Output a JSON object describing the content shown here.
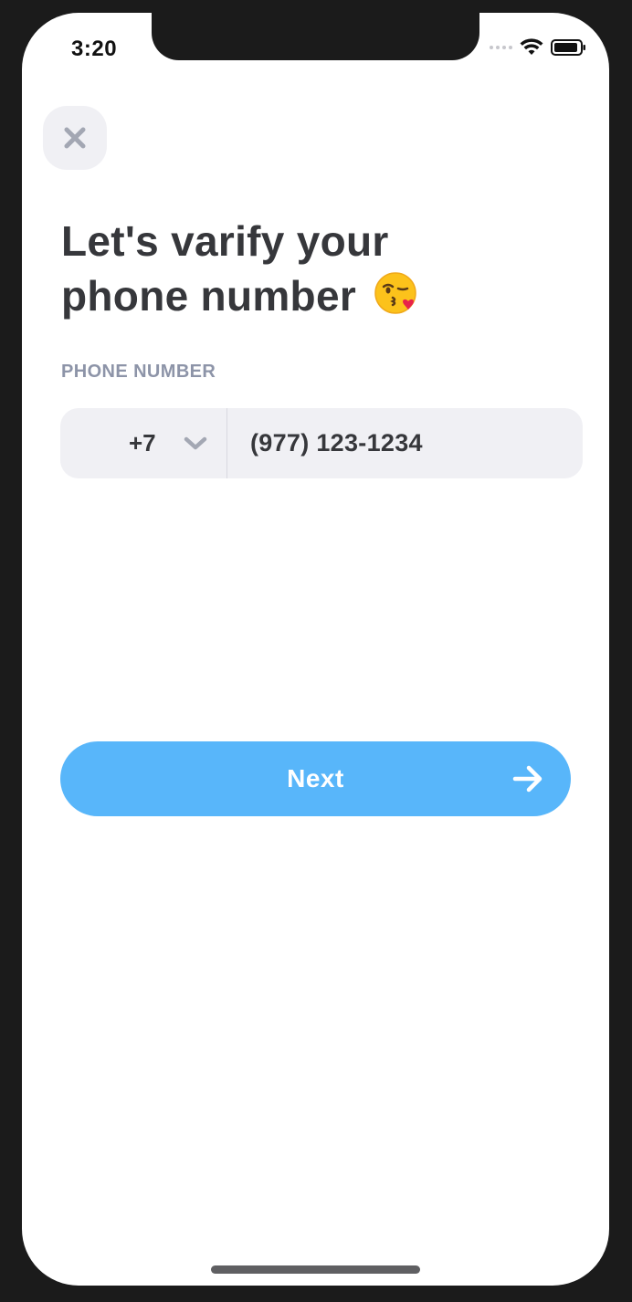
{
  "status_bar": {
    "time": "3:20"
  },
  "close_button": {
    "icon": "close-icon"
  },
  "heading": {
    "line1": "Let's varify your",
    "line2": "phone number",
    "emoji": "kissing-face-icon"
  },
  "phone": {
    "label": "PHONE NUMBER",
    "country_code": "+7",
    "number": "(977) 123-1234"
  },
  "next_button": {
    "label": "Next",
    "icon": "arrow-right-icon"
  },
  "colors": {
    "accent": "#58b6fa",
    "title": "#36373b",
    "label": "#8d94a8",
    "field_bg": "#f0f0f4"
  }
}
